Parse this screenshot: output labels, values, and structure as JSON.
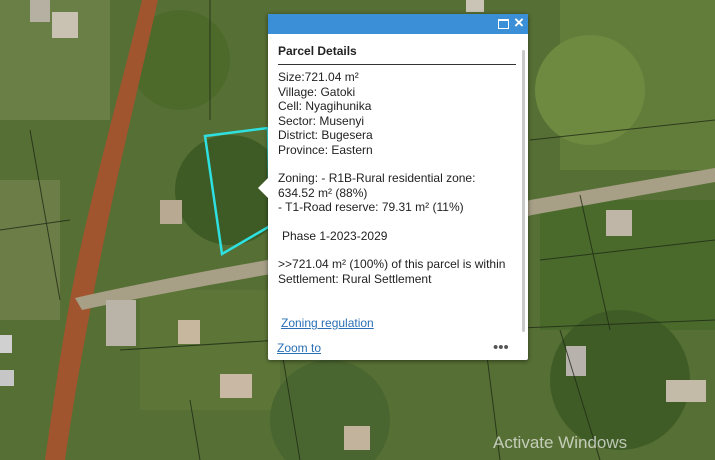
{
  "popup": {
    "title": "Parcel Details",
    "size": "Size:721.04 m²",
    "village": "Village: Gatoki",
    "cell": "Cell: Nyagihunika",
    "sector": "Sector: Musenyi",
    "district": "District: Bugesera",
    "province": "Province: Eastern",
    "zoning_line1": "Zoning:  - R1B-Rural residential zone:",
    "zoning_line2": "634.52 m² (88%)",
    "zoning_line3": "- T1-Road reserve: 79.31 m² (11%)",
    "phase": "Phase 1-2023-2029",
    "settlement_line1": ">>721.04 m² (100%) of this parcel is within",
    "settlement_line2": "Settlement: Rural Settlement",
    "zoning_regulation_link": "Zoning regulation",
    "zoom_link": "Zoom to",
    "more_icon": "more-horizontal-icon",
    "maximize_icon": "maximize-icon",
    "close_icon": "close-icon",
    "header_color": "#3b8fd6"
  },
  "map": {
    "parcel_outline_color": "#2ee0e0",
    "background": "satellite imagery"
  },
  "watermark": "Activate Windows"
}
